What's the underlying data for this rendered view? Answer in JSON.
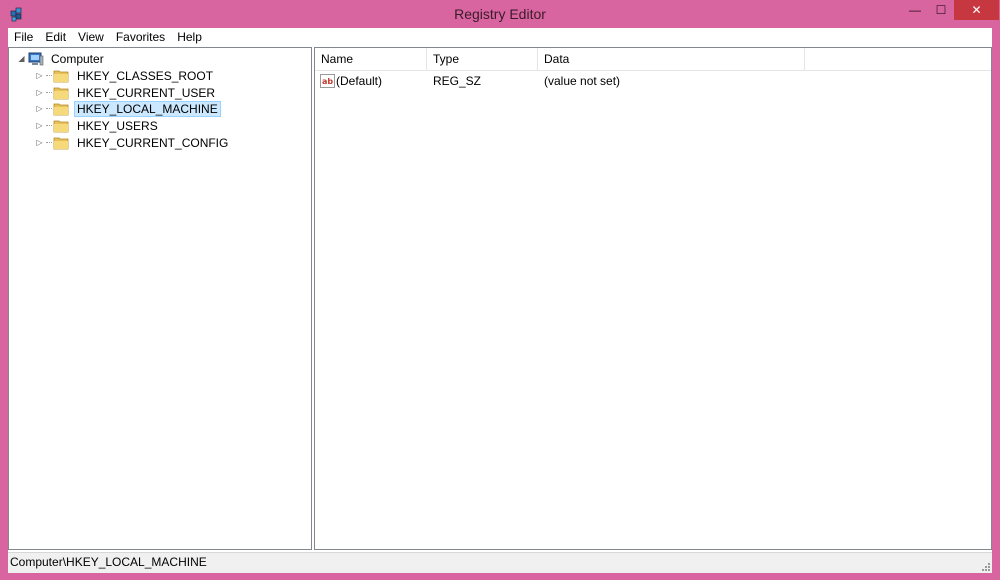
{
  "window": {
    "title": "Registry Editor",
    "close_glyph": "✕",
    "max_glyph": "☐",
    "min_glyph": "—"
  },
  "menu": [
    "File",
    "Edit",
    "View",
    "Favorites",
    "Help"
  ],
  "tree": {
    "root": {
      "label": "Computer",
      "icon": "computer-icon",
      "expanded": true
    },
    "children": [
      {
        "label": "HKEY_CLASSES_ROOT",
        "selected": false
      },
      {
        "label": "HKEY_CURRENT_USER",
        "selected": false
      },
      {
        "label": "HKEY_LOCAL_MACHINE",
        "selected": true
      },
      {
        "label": "HKEY_USERS",
        "selected": false
      },
      {
        "label": "HKEY_CURRENT_CONFIG",
        "selected": false
      }
    ]
  },
  "list": {
    "columns": [
      "Name",
      "Type",
      "Data"
    ],
    "rows": [
      {
        "name": "(Default)",
        "type": "REG_SZ",
        "data": "(value not set)",
        "icon": "string-value-icon"
      }
    ]
  },
  "status": {
    "path": "Computer\\HKEY_LOCAL_MACHINE"
  },
  "colors": {
    "frame": "#d8659f",
    "selection": "#cce8ff",
    "close_button": "#c7373f"
  }
}
